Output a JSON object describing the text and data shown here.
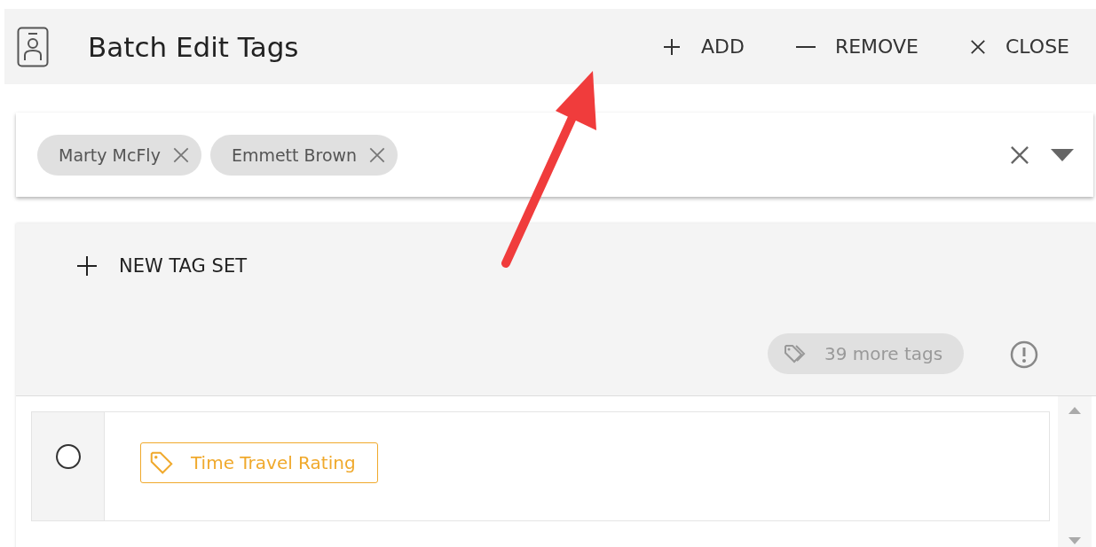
{
  "header": {
    "title": "Batch Edit Tags",
    "actions": [
      {
        "kind": "add",
        "label": "ADD"
      },
      {
        "kind": "remove",
        "label": "REMOVE"
      },
      {
        "kind": "close",
        "label": "CLOSE"
      }
    ]
  },
  "selector": {
    "chips": [
      {
        "label": "Marty McFly"
      },
      {
        "label": "Emmett Brown"
      }
    ]
  },
  "panel": {
    "new_tag_set": "NEW TAG SET",
    "more_tags": "39 more tags",
    "rows": [
      {
        "selected": false,
        "tag": "Time Travel Rating"
      }
    ]
  }
}
